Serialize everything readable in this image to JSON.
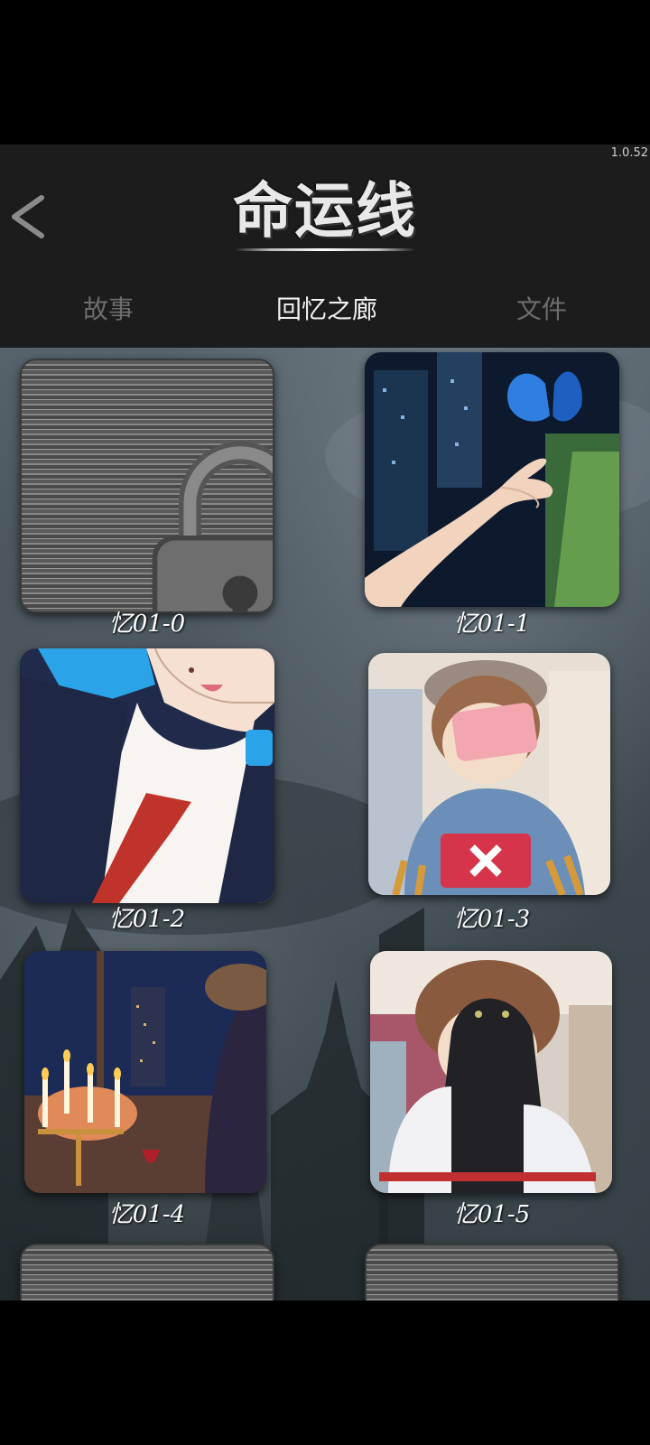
{
  "app": {
    "version": "1.0.52",
    "title": "命运线"
  },
  "tabs": [
    {
      "label": "故事",
      "active": false
    },
    {
      "label": "回忆之廊",
      "active": true
    },
    {
      "label": "文件",
      "active": false
    }
  ],
  "gallery": {
    "items": [
      {
        "label": "忆01-0",
        "locked": true
      },
      {
        "label": "忆01-1",
        "locked": false,
        "art": "hand-butterfly-night-city"
      },
      {
        "label": "忆01-2",
        "locked": false,
        "art": "student-red-tie"
      },
      {
        "label": "忆01-3",
        "locked": false,
        "art": "boy-phone-cap"
      },
      {
        "label": "忆01-4",
        "locked": false,
        "art": "candles-window-night"
      },
      {
        "label": "忆01-5",
        "locked": false,
        "art": "boy-black-cat"
      }
    ]
  },
  "colors": {
    "header_bg": "#1c1c1c",
    "tab_active": "#f2f2f2",
    "tab_inactive": "#6d6d6d"
  }
}
